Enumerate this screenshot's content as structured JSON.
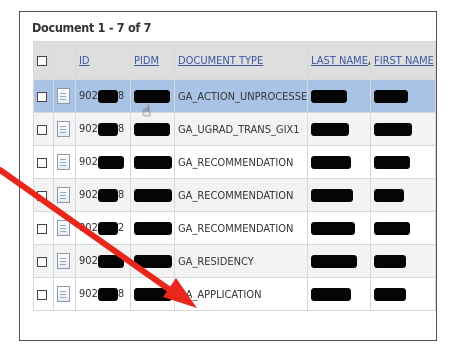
{
  "title": "Document 1 - 7 of 7",
  "columns": {
    "id": "ID",
    "pidm": "PIDM",
    "doc_type": "DOCUMENT TYPE",
    "last_name": "LAST NAME",
    "sort_icon": "▲",
    "first_name": "FIRST NAME"
  },
  "rows": [
    {
      "id_prefix": "902",
      "id_suffix": "8",
      "doc_type": "GA_ACTION_UNPROCESSED",
      "selected": true
    },
    {
      "id_prefix": "902",
      "id_suffix": "8",
      "doc_type": "GA_UGRAD_TRANS_GIX1"
    },
    {
      "id_prefix": "902",
      "id_suffix": "",
      "doc_type": "GA_RECOMMENDATION"
    },
    {
      "id_prefix": "902",
      "id_suffix": "8",
      "doc_type": "GA_RECOMMENDATION"
    },
    {
      "id_prefix": "902",
      "id_suffix": "2",
      "doc_type": "GA_RECOMMENDATION"
    },
    {
      "id_prefix": "902",
      "id_suffix": "",
      "doc_type": "GA_RESIDENCY"
    },
    {
      "id_prefix": "902",
      "id_suffix": "8",
      "doc_type": "GA_APPLICATION"
    }
  ],
  "colors": {
    "selected_row": "#a9c3e7",
    "header_bg": "#dedede",
    "link": "#3c57a6",
    "arrow": "#e8261c",
    "redaction": "#050505"
  },
  "icons": [
    "checkbox-icon",
    "document-icon",
    "sort-ascending-icon",
    "hand-cursor-icon",
    "red-arrow-annotation"
  ]
}
